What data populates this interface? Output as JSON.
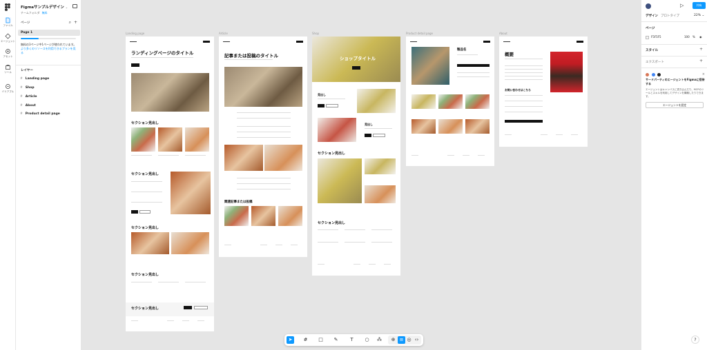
{
  "file": {
    "title": "Figmaサンプルデザイン",
    "team": "チームフォルダ",
    "plan": "無料"
  },
  "rail": [
    {
      "label": "ファイル",
      "icon": "file-icon"
    },
    {
      "label": "エージェント",
      "icon": "agent-icon"
    },
    {
      "label": "アセット",
      "icon": "assets-icon"
    },
    {
      "label": "ツール",
      "icon": "tools-icon"
    },
    {
      "label": "バリアブル",
      "icon": "variables-icon"
    }
  ],
  "pages": {
    "header": "ページ",
    "items": [
      "Page 1"
    ],
    "upsell_text": "無料の3ページ中1ページが使われています。",
    "upsell_link": "より多くのリソースを利用できるプランを見る"
  },
  "layers": {
    "header": "レイヤー",
    "items": [
      "Landing page",
      "Shop",
      "Article",
      "About",
      "Product detail page"
    ]
  },
  "frames": {
    "landing": {
      "label": "Landing page",
      "hero": "ランディングページのタイトル",
      "section1": "セクション見出し",
      "section2": "セクション見出し",
      "section3": "セクション見出し",
      "section4": "セクション見出し",
      "section5": "セクション見出し"
    },
    "article": {
      "label": "Article",
      "hero": "記事または投稿のタイトル",
      "related": "関連記事または投稿"
    },
    "shop": {
      "label": "Shop",
      "hero": "ショップタイトル",
      "sub1": "見出し",
      "sub2": "見出し",
      "section": "セクション見出し",
      "section2": "セクション見出し"
    },
    "product": {
      "label": "Product detail page",
      "title": "製品名"
    },
    "about": {
      "label": "About",
      "hero": "概要",
      "form": "お問い合わせはこちら"
    }
  },
  "right_panel": {
    "share": "共有",
    "tab_design": "デザイン",
    "tab_proto": "プロトタイプ",
    "zoom": "22%",
    "page_section": "ページ",
    "fill_hex": "F5F5F5",
    "fill_opacity": "100",
    "fill_unit": "%",
    "styles": "スタイル",
    "export": "エクスポート",
    "agent_title": "サードパーティのエージェントをFigmaに招待する",
    "agent_desc": "エージェントはキャンバスに書き込んだり、MCPのツールとスキルを利用してデザインを構築したりできます。",
    "agent_button": "エージェントを設定"
  },
  "toolbar": {
    "tools": [
      "move-tool-icon",
      "frame-tool-icon",
      "shape-tool-icon",
      "pen-tool-icon",
      "text-tool-icon",
      "comment-tool-icon",
      "actions-icon",
      "dev-mode-icon"
    ]
  },
  "help": "?"
}
